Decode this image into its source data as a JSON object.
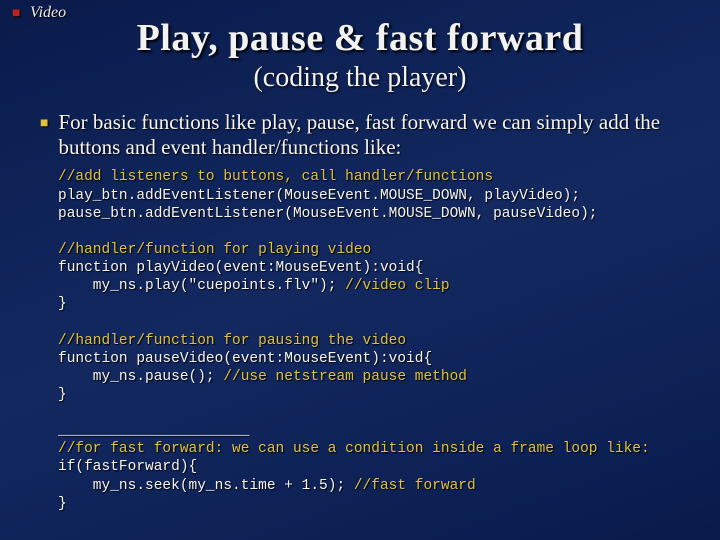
{
  "category": "Video",
  "title": "Play, pause & fast forward",
  "subtitle": "(coding the player)",
  "bullet": "For basic functions like play, pause, fast forward we can simply add the buttons and event handler/functions like:",
  "code": {
    "c1": "//add listeners to buttons, call handler/functions",
    "l1": "play_btn.addEventListener(MouseEvent.MOUSE_DOWN, playVideo);",
    "l2": "pause_btn.addEventListener(MouseEvent.MOUSE_DOWN, pauseVideo);",
    "c2": "//handler/function for playing video",
    "l3": "function playVideo(event:MouseEvent):void{",
    "l4": "    my_ns.play(\"cuepoints.flv\"); ",
    "c3": "//video clip",
    "l5": "}",
    "c4": "//handler/function for pausing the video",
    "l6": "function pauseVideo(event:MouseEvent):void{",
    "l7": "    my_ns.pause(); ",
    "c5": "//use netstream pause method",
    "l8": "}",
    "hr": "______________________",
    "c6": "//for fast forward: we can use a condition inside a frame loop like:",
    "l9": "if(fastForward){",
    "l10": "    my_ns.seek(my_ns.time + 1.5); ",
    "c7": "//fast forward",
    "l11": "}"
  }
}
